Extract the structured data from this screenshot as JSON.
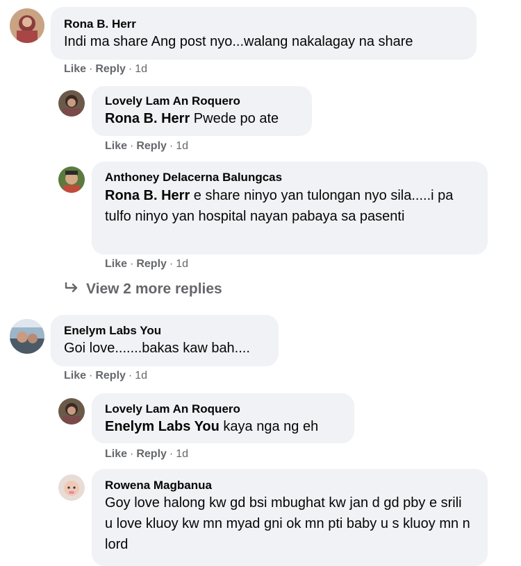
{
  "comments": [
    {
      "author": "Rona B. Herr",
      "mention": "",
      "text": "Indi ma share Ang post nyo...walang nakalagay na share",
      "like": "Like",
      "reply": "Reply",
      "time": "1d"
    },
    {
      "author": "Lovely Lam An Roquero",
      "mention": "Rona B. Herr",
      "text": " Pwede po ate",
      "like": "Like",
      "reply": "Reply",
      "time": "1d"
    },
    {
      "author": "Anthoney Delacerna Balungcas",
      "mention": "Rona B. Herr",
      "text": " e share ninyo yan tulongan nyo sila.....i pa tulfo ninyo yan hospital nayan pabaya sa pasenti",
      "like": "Like",
      "reply": "Reply",
      "time": "1d"
    },
    {
      "author": "Enelym Labs You",
      "mention": "",
      "text": "Goi love.......bakas kaw bah....",
      "like": "Like",
      "reply": "Reply",
      "time": "1d"
    },
    {
      "author": "Lovely Lam An Roquero",
      "mention": "Enelym Labs You",
      "text": " kaya nga ng eh",
      "like": "Like",
      "reply": "Reply",
      "time": "1d"
    },
    {
      "author": "Rowena Magbanua",
      "mention": "",
      "text": "Goy love halong kw gd bsi mbughat kw jan d gd pby e srili u love kluoy kw mn myad gni ok mn pti baby u s kluoy mn n lord"
    }
  ],
  "view_more": "View 2 more replies",
  "separator": "·"
}
